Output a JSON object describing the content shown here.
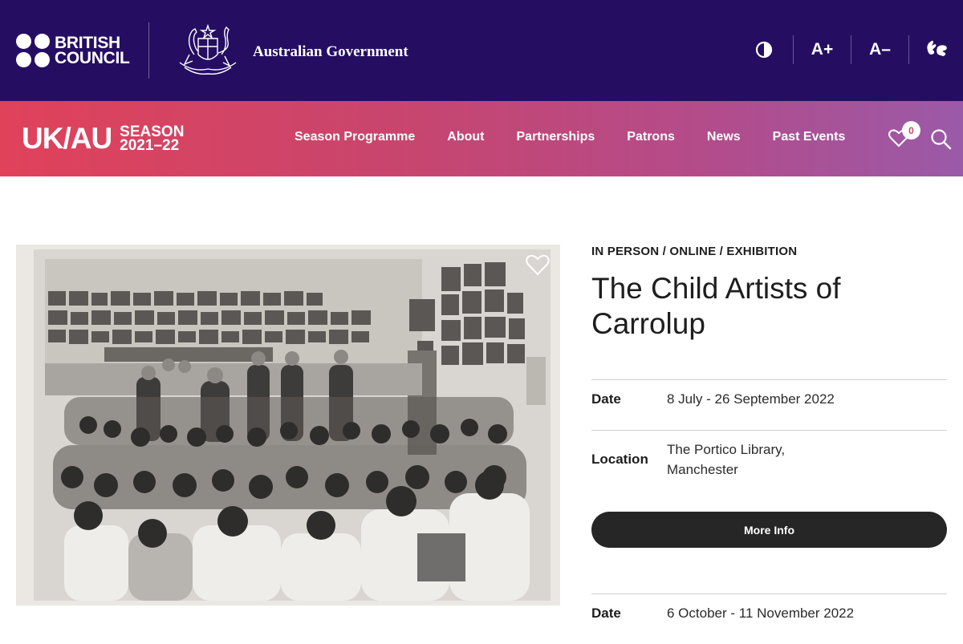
{
  "header": {
    "british_council": [
      "BRITISH",
      "COUNCIL"
    ],
    "gov_text": "Australian Government",
    "tools": {
      "font_increase": "A+",
      "font_decrease": "A–"
    }
  },
  "nav": {
    "logo_main": "UK/AU",
    "logo_season": "SEASON",
    "logo_years": "2021–22",
    "links": [
      "Season Programme",
      "About",
      "Partnerships",
      "Patrons",
      "News",
      "Past Events"
    ],
    "favourites_count": "0"
  },
  "event": {
    "category": "IN PERSON / ONLINE / EXHIBITION",
    "title": "The Child Artists of Carrolup",
    "date_label": "Date",
    "date_value": "8 July - 26 September 2022",
    "location_label": "Location",
    "location_line1": "The Portico Library,",
    "location_line2": "Manchester",
    "more_info": "More Info",
    "date2_label": "Date",
    "date2_value": "6 October - 11 November 2022"
  },
  "colors": {
    "topbar": "#250e62",
    "nav_gradient_start": "#e0425a",
    "nav_gradient_end": "#9a5aa8",
    "button": "#262626"
  },
  "icons": {
    "contrast": "contrast-icon",
    "sign_language": "sign-language-icon",
    "favourite": "heart-icon",
    "search": "search-icon"
  }
}
